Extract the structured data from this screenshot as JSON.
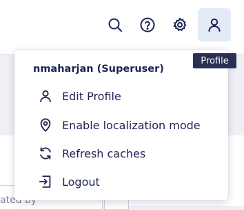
{
  "colors": {
    "text": "#1d2455",
    "profile_button_bg": "#e3ebf6",
    "tooltip_bg": "#2a2f55"
  },
  "toolbar": {
    "icons": [
      "search-icon",
      "help-icon",
      "settings-icon",
      "user-icon"
    ]
  },
  "tooltip": {
    "text": "Profile"
  },
  "menu": {
    "user_label": "nmaharjan (Superuser)",
    "items": [
      {
        "label": "Edit Profile",
        "icon": "user-icon"
      },
      {
        "label": "Enable localization mode",
        "icon": "location-pin-icon"
      },
      {
        "label": "Refresh caches",
        "icon": "refresh-icon"
      },
      {
        "label": "Logout",
        "icon": "logout-icon"
      }
    ]
  },
  "background": {
    "partial_field_text": "ated by"
  }
}
